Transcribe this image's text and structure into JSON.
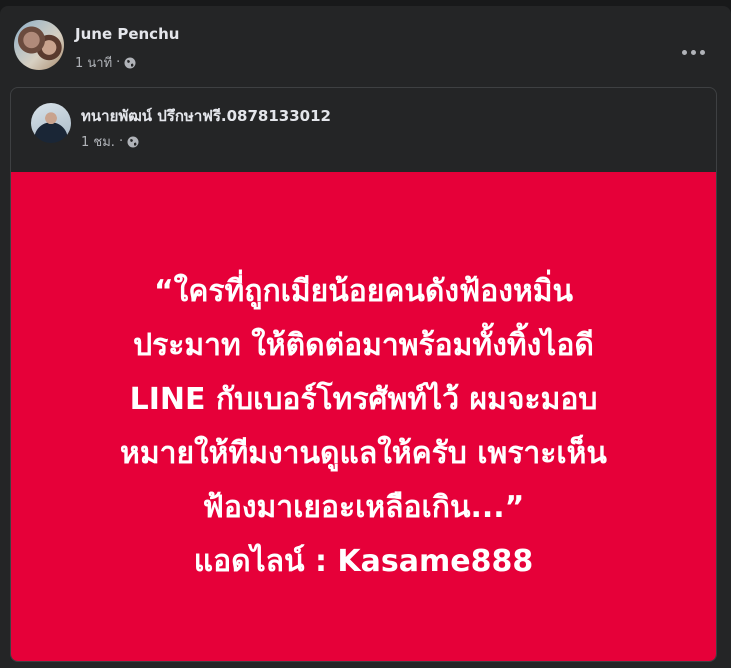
{
  "post": {
    "author": "June Penchu",
    "time": "1 นาที",
    "separator": "·",
    "privacy_icon": "globe-icon",
    "more_icon": "more-options-icon"
  },
  "shared_post": {
    "author": "ทนายพัฒน์ ปรึกษาฟรี.0878133012",
    "time": "1 ชม.",
    "separator": "·",
    "privacy_icon": "globe-icon",
    "background_color": "#e60039",
    "text_color": "#ffffff",
    "lines": [
      "“ใครที่ถูกเมียน้อยคนดังฟ้องหมิ่น",
      "ประมาท ให้ติดต่อมาพร้อมทั้งทิ้งไอดี",
      "LINE กับเบอร์โทรศัพท์ไว้ ผมจะมอบ",
      "หมายให้ทีมงานดูแลให้ครับ เพราะเห็น",
      "ฟ้องมาเยอะเหลือเกิน...”",
      "แอดไลน์ : Kasame888"
    ]
  }
}
